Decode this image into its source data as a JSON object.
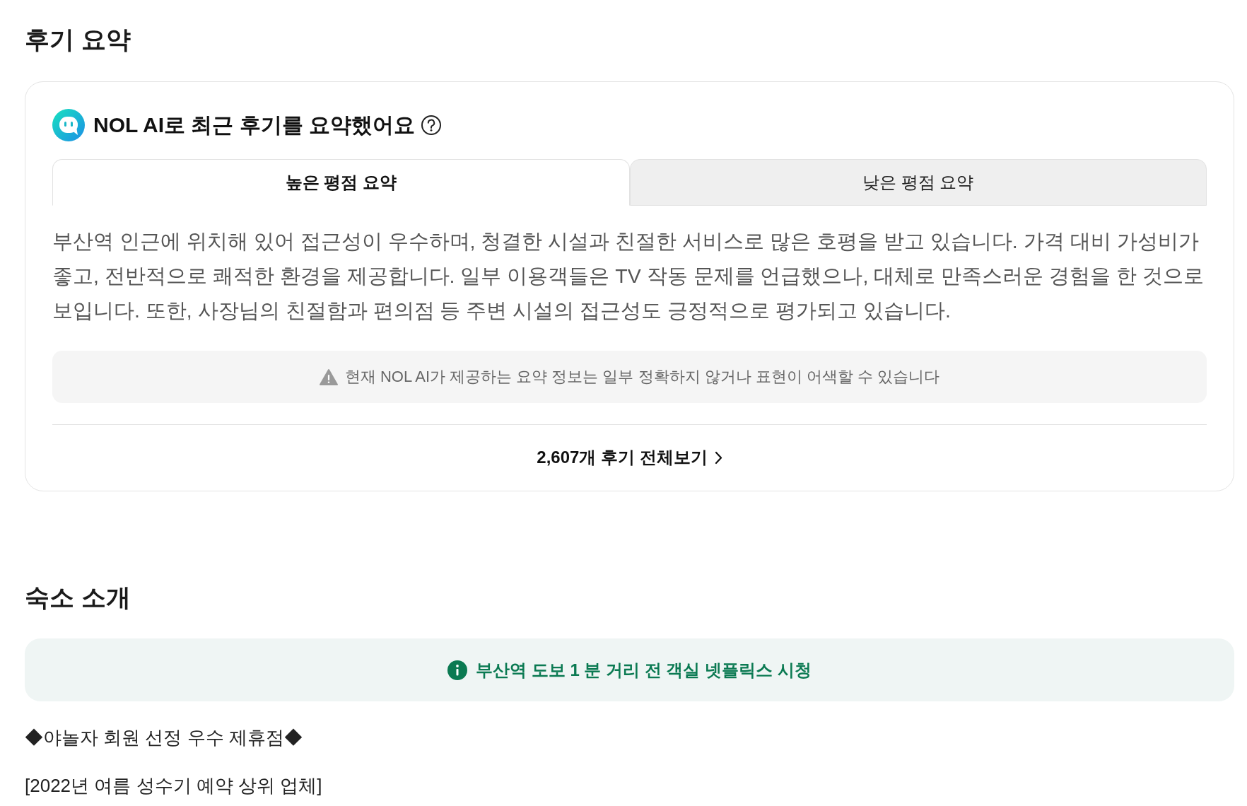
{
  "review_summary": {
    "title": "후기 요약",
    "ai_heading": "NOL AI로 최근 후기를 요약했어요",
    "tabs": [
      {
        "label": "높은 평점 요약",
        "selected": true
      },
      {
        "label": "낮은 평점 요약",
        "selected": false
      }
    ],
    "summary": "부산역 인근에 위치해 있어 접근성이 우수하며, 청결한 시설과 친절한 서비스로 많은 호평을 받고 있습니다. 가격 대비 가성비가 좋고, 전반적으로 쾌적한 환경을 제공합니다. 일부 이용객들은 TV 작동 문제를 언급했으나, 대체로 만족스러운 경험을 한 것으로 보입니다. 또한, 사장님의 친절함과 편의점 등 주변 시설의 접근성도 긍정적으로 평가되고 있습니다.",
    "notice": "현재 NOL AI가 제공하는 요약 정보는 일부 정확하지 않거나 표현이 어색할 수 있습니다",
    "view_all_link": "2,607개 후기 전체보기"
  },
  "property_intro": {
    "title": "숙소 소개",
    "highlight": "부산역 도보 1 분 거리 전 객실 넷플릭스 시청",
    "description_lines": [
      "◆야놀자 회원 선정 우수 제휴점◆",
      "[2022년 여름 성수기 예약 상위 업체]"
    ]
  }
}
